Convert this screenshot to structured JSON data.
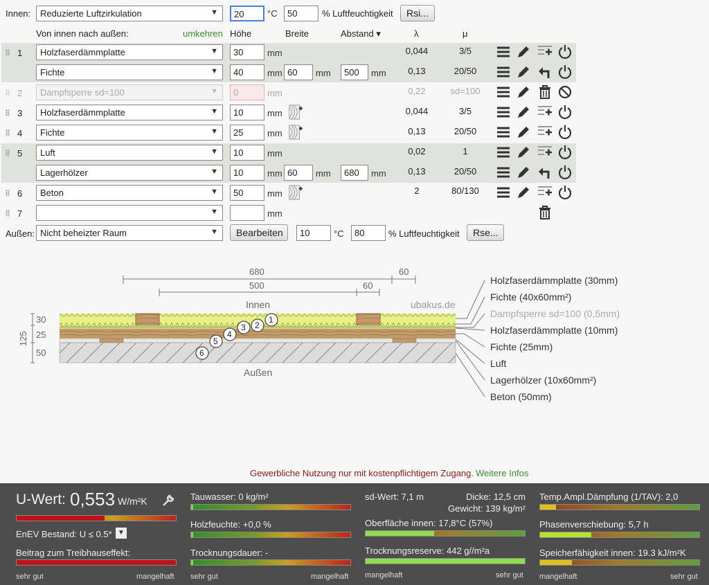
{
  "header": {
    "innen_label": "Innen:",
    "innen_select": "Reduzierte Luftzirkulation",
    "temp_in": "20",
    "temp_unit": "°C",
    "humid_in": "50",
    "humid_label": "% Luftfeuchtigkeit",
    "rsi_button": "Rsi..."
  },
  "columns": {
    "direction": "Von innen nach außen:",
    "reverse": "umkehren",
    "height": "Höhe",
    "width": "Breite",
    "spacing": "Abstand ▾",
    "lambda": "λ",
    "mu": "μ"
  },
  "unit_mm": "mm",
  "layers": [
    {
      "num": "1",
      "material": "Holzfaserdämmplatte",
      "height": "30",
      "lambda": "0,044",
      "mu": "3/5"
    },
    {
      "num": "",
      "material": "Fichte",
      "height": "40",
      "width": "60",
      "spacing": "500",
      "lambda": "0,13",
      "mu": "20/50"
    },
    {
      "num": "2",
      "material": "Dampfsperre sd=100",
      "height": "0",
      "lambda": "0,22",
      "mu": "sd=100"
    },
    {
      "num": "3",
      "material": "Holzfaserdämmplatte",
      "height": "10",
      "lambda": "0,044",
      "mu": "3/5"
    },
    {
      "num": "4",
      "material": "Fichte",
      "height": "25",
      "lambda": "0,13",
      "mu": "20/50"
    },
    {
      "num": "5",
      "material": "Luft",
      "height": "10",
      "lambda": "0,02",
      "mu": "1"
    },
    {
      "num": "",
      "material": "Lagerhölzer",
      "height": "10",
      "width": "60",
      "spacing": "680",
      "lambda": "0,13",
      "mu": "20/50"
    },
    {
      "num": "6",
      "material": "Beton",
      "height": "50",
      "lambda": "2",
      "mu": "80/130"
    },
    {
      "num": "7",
      "material": "",
      "height": ""
    }
  ],
  "outside": {
    "label": "Außen:",
    "select": "Nicht beheizter Raum",
    "edit_button": "Bearbeiten",
    "temp": "10",
    "temp_unit": "°C",
    "humid": "80",
    "humid_label": "% Luftfeuchtigkeit",
    "rse_button": "Rse..."
  },
  "diagram": {
    "dim_680": "680",
    "dim_60a": "60",
    "dim_500": "500",
    "dim_60b": "60",
    "innen": "Innen",
    "aussen": "Außen",
    "watermark": "ubakus.de",
    "side_30": "30",
    "side_25": "25",
    "side_125": "125",
    "side_50": "50",
    "markers": [
      "1",
      "2",
      "3",
      "4",
      "5",
      "6"
    ],
    "legend": [
      "Holzfaserdämmplatte (30mm)",
      "Fichte (40x60mm²)",
      "Dampfsperre sd=100 (0,5mm)",
      "Holzfaserdämmplatte (10mm)",
      "Fichte (25mm)",
      "Luft",
      "Lagerhölzer (10x60mm²)",
      "Beton (50mm)"
    ]
  },
  "notice": {
    "text": "Gewerbliche Nutzung nur mit kostenpflichtigem Zugang.",
    "link": "Weitere Infos"
  },
  "footer": {
    "u_label": "U-Wert:",
    "u_value": "0,553",
    "u_unit": "W/m²K",
    "u_bar_fraction": 0.55,
    "enev": "EnEV Bestand: U ≤ 0.5*",
    "treibhaus": "Beitrag zum Treibhauseffekt:",
    "treibhaus_fraction": 1.0,
    "sehr_gut": "sehr gut",
    "mangelhaft": "mangelhaft",
    "tauwasser": "Tauwasser: 0 kg/m²",
    "holzfeuchte": "Holzfeuchte: +0,0 %",
    "trocknungsdauer": "Trocknungsdauer: -",
    "sd_wert": "sd-Wert: 7,1 m",
    "dicke": "Dicke: 12,5 cm",
    "gewicht": "Gewicht: 139 kg/m²",
    "oberflaeche": "Oberfläche innen: 17,8°C (57%)",
    "oberflaeche_fraction": 0.43,
    "trocknungsreserve": "Trocknungsreserve: 442 g//m²a",
    "trocknungsreserve_fraction": 1.0,
    "temp_ampl": "Temp.Ampl.Dämpfung (1/TAV): 2,0",
    "temp_ampl_fraction": 0.1,
    "phasen": "Phasenverschiebung: 5,7 h",
    "phasen_fraction": 0.32,
    "speicher": "Speicherfähigkeit innen: 19.3 kJ/m²K",
    "speicher_fraction": 0.2,
    "colors": {
      "bad": "#c0101a",
      "good": "#8ee04a",
      "mid": "#e0c020"
    }
  }
}
